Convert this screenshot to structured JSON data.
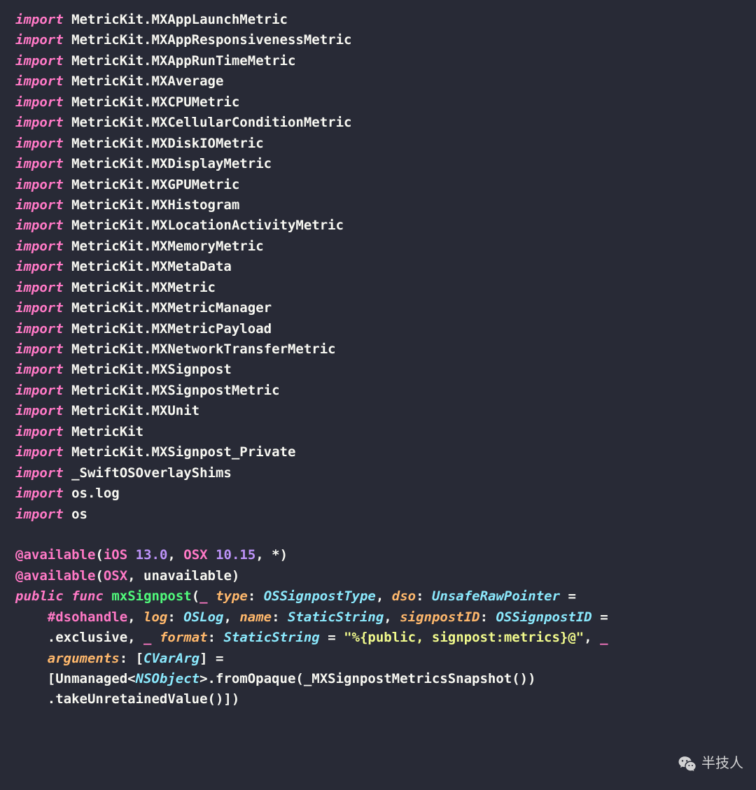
{
  "lines": [
    {
      "type": "import",
      "keyword": "import",
      "module": "MetricKit.MXAppLaunchMetric"
    },
    {
      "type": "import",
      "keyword": "import",
      "module": "MetricKit.MXAppResponsivenessMetric"
    },
    {
      "type": "import",
      "keyword": "import",
      "module": "MetricKit.MXAppRunTimeMetric"
    },
    {
      "type": "import",
      "keyword": "import",
      "module": "MetricKit.MXAverage"
    },
    {
      "type": "import",
      "keyword": "import",
      "module": "MetricKit.MXCPUMetric"
    },
    {
      "type": "import",
      "keyword": "import",
      "module": "MetricKit.MXCellularConditionMetric"
    },
    {
      "type": "import",
      "keyword": "import",
      "module": "MetricKit.MXDiskIOMetric"
    },
    {
      "type": "import",
      "keyword": "import",
      "module": "MetricKit.MXDisplayMetric"
    },
    {
      "type": "import",
      "keyword": "import",
      "module": "MetricKit.MXGPUMetric"
    },
    {
      "type": "import",
      "keyword": "import",
      "module": "MetricKit.MXHistogram"
    },
    {
      "type": "import",
      "keyword": "import",
      "module": "MetricKit.MXLocationActivityMetric"
    },
    {
      "type": "import",
      "keyword": "import",
      "module": "MetricKit.MXMemoryMetric"
    },
    {
      "type": "import",
      "keyword": "import",
      "module": "MetricKit.MXMetaData"
    },
    {
      "type": "import",
      "keyword": "import",
      "module": "MetricKit.MXMetric"
    },
    {
      "type": "import",
      "keyword": "import",
      "module": "MetricKit.MXMetricManager"
    },
    {
      "type": "import",
      "keyword": "import",
      "module": "MetricKit.MXMetricPayload"
    },
    {
      "type": "import",
      "keyword": "import",
      "module": "MetricKit.MXNetworkTransferMetric"
    },
    {
      "type": "import",
      "keyword": "import",
      "module": "MetricKit.MXSignpost"
    },
    {
      "type": "import",
      "keyword": "import",
      "module": "MetricKit.MXSignpostMetric"
    },
    {
      "type": "import",
      "keyword": "import",
      "module": "MetricKit.MXUnit"
    },
    {
      "type": "import",
      "keyword": "import",
      "module": "MetricKit"
    },
    {
      "type": "import",
      "keyword": "import",
      "module": "MetricKit.MXSignpost_Private"
    },
    {
      "type": "import",
      "keyword": "import",
      "module": "_SwiftOSOverlayShims"
    },
    {
      "type": "import",
      "keyword": "import",
      "module": "os.log"
    },
    {
      "type": "import",
      "keyword": "import",
      "module": "os"
    },
    {
      "type": "blank"
    },
    {
      "type": "custom",
      "tokens": [
        {
          "cls": "attr",
          "text": "@available"
        },
        {
          "cls": "punct",
          "text": "("
        },
        {
          "cls": "pink",
          "text": "iOS"
        },
        {
          "cls": "punct",
          "text": " "
        },
        {
          "cls": "num",
          "text": "13.0"
        },
        {
          "cls": "punct",
          "text": ", "
        },
        {
          "cls": "pink",
          "text": "OSX"
        },
        {
          "cls": "punct",
          "text": " "
        },
        {
          "cls": "num",
          "text": "10.15"
        },
        {
          "cls": "punct",
          "text": ", *)"
        }
      ]
    },
    {
      "type": "custom",
      "tokens": [
        {
          "cls": "attr",
          "text": "@available"
        },
        {
          "cls": "punct",
          "text": "("
        },
        {
          "cls": "pink",
          "text": "OSX"
        },
        {
          "cls": "punct",
          "text": ", unavailable)"
        }
      ]
    },
    {
      "type": "custom",
      "tokens": [
        {
          "cls": "kw",
          "text": "public"
        },
        {
          "cls": "punct",
          "text": " "
        },
        {
          "cls": "kw",
          "text": "func"
        },
        {
          "cls": "punct",
          "text": " "
        },
        {
          "cls": "func",
          "text": "mxSignpost"
        },
        {
          "cls": "punct",
          "text": "("
        },
        {
          "cls": "pink",
          "text": "_"
        },
        {
          "cls": "punct",
          "text": " "
        },
        {
          "cls": "param",
          "text": "type"
        },
        {
          "cls": "punct",
          "text": ": "
        },
        {
          "cls": "type",
          "text": "OSSignpostType"
        },
        {
          "cls": "punct",
          "text": ", "
        },
        {
          "cls": "param",
          "text": "dso"
        },
        {
          "cls": "punct",
          "text": ": "
        },
        {
          "cls": "type",
          "text": "UnsafeRawPointer"
        },
        {
          "cls": "punct",
          "text": " = "
        }
      ]
    },
    {
      "type": "custom",
      "tokens": [
        {
          "cls": "punct",
          "text": "    "
        },
        {
          "cls": "attr",
          "text": "#dsohandle"
        },
        {
          "cls": "punct",
          "text": ", "
        },
        {
          "cls": "param",
          "text": "log"
        },
        {
          "cls": "punct",
          "text": ": "
        },
        {
          "cls": "type",
          "text": "OSLog"
        },
        {
          "cls": "punct",
          "text": ", "
        },
        {
          "cls": "param",
          "text": "name"
        },
        {
          "cls": "punct",
          "text": ": "
        },
        {
          "cls": "type",
          "text": "StaticString"
        },
        {
          "cls": "punct",
          "text": ", "
        },
        {
          "cls": "param",
          "text": "signpostID"
        },
        {
          "cls": "punct",
          "text": ": "
        },
        {
          "cls": "type",
          "text": "OSSignpostID"
        },
        {
          "cls": "punct",
          "text": " = "
        }
      ]
    },
    {
      "type": "custom",
      "tokens": [
        {
          "cls": "punct",
          "text": "    .exclusive, "
        },
        {
          "cls": "pink",
          "text": "_"
        },
        {
          "cls": "punct",
          "text": " "
        },
        {
          "cls": "param",
          "text": "format"
        },
        {
          "cls": "punct",
          "text": ": "
        },
        {
          "cls": "type",
          "text": "StaticString"
        },
        {
          "cls": "punct",
          "text": " = "
        },
        {
          "cls": "str",
          "text": "\"%{public, signpost:metrics}@\""
        },
        {
          "cls": "punct",
          "text": ", "
        },
        {
          "cls": "pink",
          "text": "_"
        },
        {
          "cls": "punct",
          "text": " "
        }
      ]
    },
    {
      "type": "custom",
      "tokens": [
        {
          "cls": "punct",
          "text": "    "
        },
        {
          "cls": "param",
          "text": "arguments"
        },
        {
          "cls": "punct",
          "text": ": ["
        },
        {
          "cls": "type",
          "text": "CVarArg"
        },
        {
          "cls": "punct",
          "text": "] = "
        }
      ]
    },
    {
      "type": "custom",
      "tokens": [
        {
          "cls": "punct",
          "text": "    [Unmanaged<"
        },
        {
          "cls": "type",
          "text": "NSObject"
        },
        {
          "cls": "punct",
          "text": ">.fromOpaque(_MXSignpostMetricsSnapshot())"
        }
      ]
    },
    {
      "type": "custom",
      "tokens": [
        {
          "cls": "punct",
          "text": "    .takeUnretainedValue()])"
        }
      ]
    }
  ],
  "watermark": {
    "text": "半技人"
  }
}
